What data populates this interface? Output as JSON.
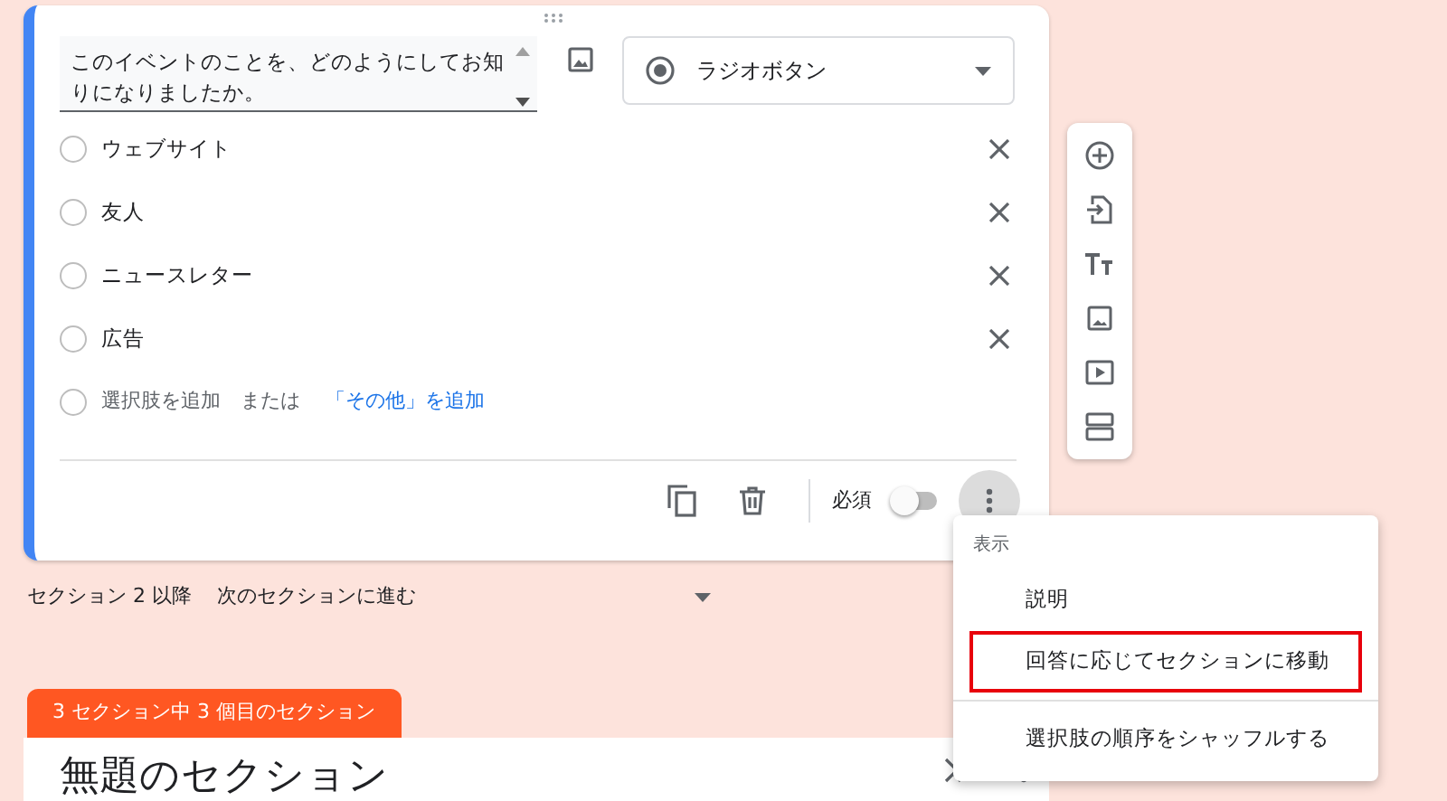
{
  "question": {
    "title": "このイベントのことを、どのようにしてお知りになりましたか。",
    "type": "ラジオボタン"
  },
  "options": [
    {
      "label": "ウェブサイト"
    },
    {
      "label": "友人"
    },
    {
      "label": "ニュースレター"
    },
    {
      "label": "広告"
    }
  ],
  "add_option": {
    "text": "選択肢を追加",
    "or": "または",
    "link": "「その他」を追加"
  },
  "footer": {
    "required_label": "必須",
    "required_on": false
  },
  "after_section": {
    "label": "セクション 2 以降",
    "value": "次のセクションに進む"
  },
  "next_section": {
    "tab": "3 セクション中 3 個目のセクション",
    "title": "無題のセクション"
  },
  "menu": {
    "header": "表示",
    "items": [
      {
        "label": "説明",
        "highlighted": false
      },
      {
        "label": "回答に応じてセクションに移動",
        "highlighted": true
      },
      {
        "label": "選択肢の順序をシャッフルする",
        "highlighted": false
      }
    ]
  }
}
